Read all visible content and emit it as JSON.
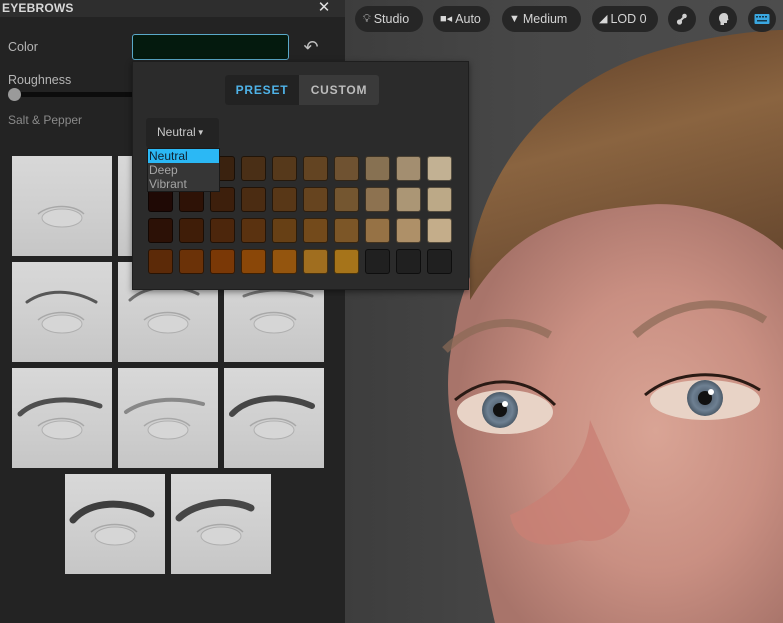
{
  "panel": {
    "title": "EYEBROWS",
    "close_icon": "close-icon",
    "color_label": "Color",
    "color_value": "#041a0e",
    "undo_icon": "undo-icon",
    "roughness_label": "Roughness",
    "roughness_value": 0,
    "salt_pepper_label": "Salt & Pepper",
    "eyebrow_presets": [
      {
        "name": "none"
      },
      {
        "name": "eyebrow-2"
      },
      {
        "name": "eyebrow-3"
      },
      {
        "name": "eyebrow-4"
      },
      {
        "name": "eyebrow-5"
      },
      {
        "name": "eyebrow-6"
      },
      {
        "name": "eyebrow-7"
      },
      {
        "name": "eyebrow-8"
      },
      {
        "name": "eyebrow-9"
      },
      {
        "name": "eyebrow-10"
      },
      {
        "name": "eyebrow-11"
      }
    ]
  },
  "toolbar": {
    "items": [
      {
        "icon": "lightbulb-icon",
        "label": "Studio"
      },
      {
        "icon": "camera-icon",
        "label": "Auto"
      },
      {
        "icon": "diamond-icon",
        "label": "Medium"
      },
      {
        "icon": "lod-icon",
        "label": "LOD 0"
      },
      {
        "icon": "bone-icon",
        "label": ""
      },
      {
        "icon": "head-icon",
        "label": ""
      },
      {
        "icon": "keyboard-icon",
        "label": ""
      }
    ],
    "keyboard_color": "#3aa7e0"
  },
  "color_popup": {
    "tabs": [
      {
        "label": "PRESET",
        "active": true
      },
      {
        "label": "CUSTOM",
        "active": false
      }
    ],
    "palette_dropdown": {
      "selected": "Neutral",
      "options": [
        "Neutral",
        "Deep",
        "Vibrant"
      ]
    },
    "accent": "#2bb8f5",
    "swatches": [
      [
        "#1a0d05",
        "#2a1508",
        "#3a220f",
        "#4a2f16",
        "#56391b",
        "#634422",
        "#6f5231",
        "#877152",
        "#a38e70",
        "#c2b193"
      ],
      [
        "#1f0905",
        "#2e1206",
        "#3d1f0c",
        "#4b2c12",
        "#583717",
        "#66441f",
        "#745630",
        "#8d7250",
        "#ab9675",
        "#bca987"
      ],
      [
        "#2c1106",
        "#3f1d08",
        "#4c260c",
        "#5a3210",
        "#674015",
        "#734a1b",
        "#7c5627",
        "#967245",
        "#ae9068",
        "#c4ad8a"
      ],
      [
        "#5c2a08",
        "#6b3208",
        "#7a3806",
        "#8a4708",
        "#94550e",
        "#a06e1f",
        "#a6741a",
        "#202020",
        "#202020",
        "#202020"
      ]
    ]
  }
}
